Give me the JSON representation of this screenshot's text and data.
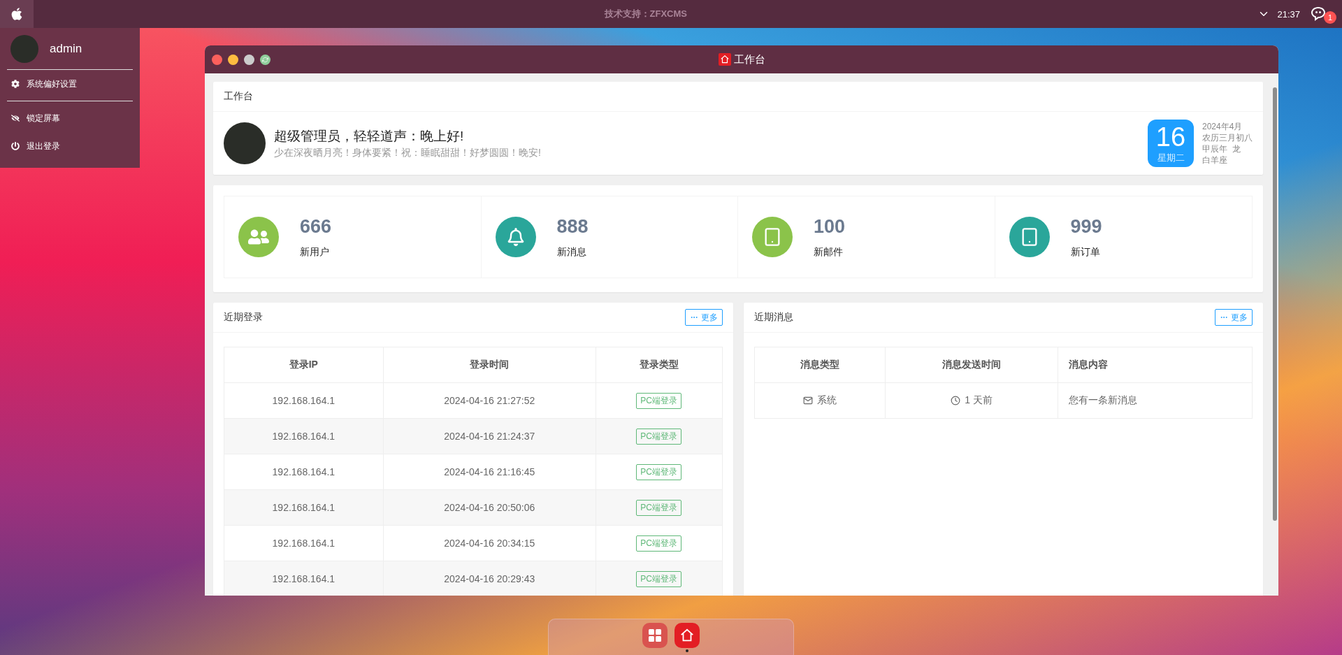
{
  "top_bar": {
    "support_text": "技术支持：ZFXCMS",
    "time": "21:37",
    "notification_count": "1"
  },
  "user_menu": {
    "username": "admin",
    "items": [
      {
        "kind": "settings",
        "label": "系统偏好设置"
      },
      {
        "kind": "lock",
        "label": "锁定屏幕"
      },
      {
        "kind": "logout",
        "label": "退出登录"
      }
    ]
  },
  "window": {
    "title": "工作台"
  },
  "welcome_card": {
    "title": "工作台",
    "greeting": "超级管理员，轻轻道声：晚上好!",
    "message": "少在深夜晒月亮！身体要紧！祝：睡眠甜甜！好梦圆圆！晚安!",
    "day": "16",
    "weekday": "星期二",
    "date_lines": [
      "2024年4月",
      "农历三月初八",
      "甲辰年  龙",
      "白羊座"
    ]
  },
  "stats": [
    {
      "value": "666",
      "label": "新用户",
      "kind": "users",
      "color": "#8bc34a"
    },
    {
      "value": "888",
      "label": "新消息",
      "kind": "bell",
      "color": "#2aa69a"
    },
    {
      "value": "100",
      "label": "新邮件",
      "kind": "tablet",
      "color": "#8bc34a"
    },
    {
      "value": "999",
      "label": "新订单",
      "kind": "tablet",
      "color": "#2aa69a"
    }
  ],
  "recent_logins": {
    "title": "近期登录",
    "more": "更多",
    "columns": [
      "登录IP",
      "登录时间",
      "登录类型"
    ],
    "rows": [
      {
        "ip": "192.168.164.1",
        "time": "2024-04-16 21:27:52",
        "type": "PC端登录"
      },
      {
        "ip": "192.168.164.1",
        "time": "2024-04-16 21:24:37",
        "type": "PC端登录"
      },
      {
        "ip": "192.168.164.1",
        "time": "2024-04-16 21:16:45",
        "type": "PC端登录"
      },
      {
        "ip": "192.168.164.1",
        "time": "2024-04-16 20:50:06",
        "type": "PC端登录"
      },
      {
        "ip": "192.168.164.1",
        "time": "2024-04-16 20:34:15",
        "type": "PC端登录"
      },
      {
        "ip": "192.168.164.1",
        "time": "2024-04-16 20:29:43",
        "type": "PC端登录"
      }
    ]
  },
  "recent_messages": {
    "title": "近期消息",
    "more": "更多",
    "columns": [
      "消息类型",
      "消息发送时间",
      "消息内容"
    ],
    "rows": [
      {
        "type": "系统",
        "time": "1 天前",
        "content": "您有一条新消息"
      }
    ]
  },
  "dock": {
    "apps": [
      {
        "kind": "grid",
        "running": false
      },
      {
        "kind": "home",
        "running": true
      }
    ]
  }
}
